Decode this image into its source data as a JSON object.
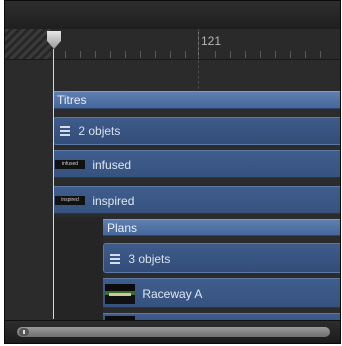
{
  "ruler": {
    "marker_label": "121"
  },
  "titres": {
    "header": "Titres",
    "collapsed_label": "2 objets",
    "clips": [
      {
        "thumb_text": "infused",
        "label": "infused"
      },
      {
        "thumb_text": "inspired",
        "label": "inspired"
      }
    ]
  },
  "plans": {
    "header": "Plans",
    "collapsed_label": "3 objets",
    "clips": [
      {
        "label": "Raceway A"
      }
    ]
  },
  "colors": {
    "group_header": "#4f6fa3",
    "clip": "#3b5887",
    "background": "#2b2b2b",
    "playhead": "#d8d8d8"
  }
}
